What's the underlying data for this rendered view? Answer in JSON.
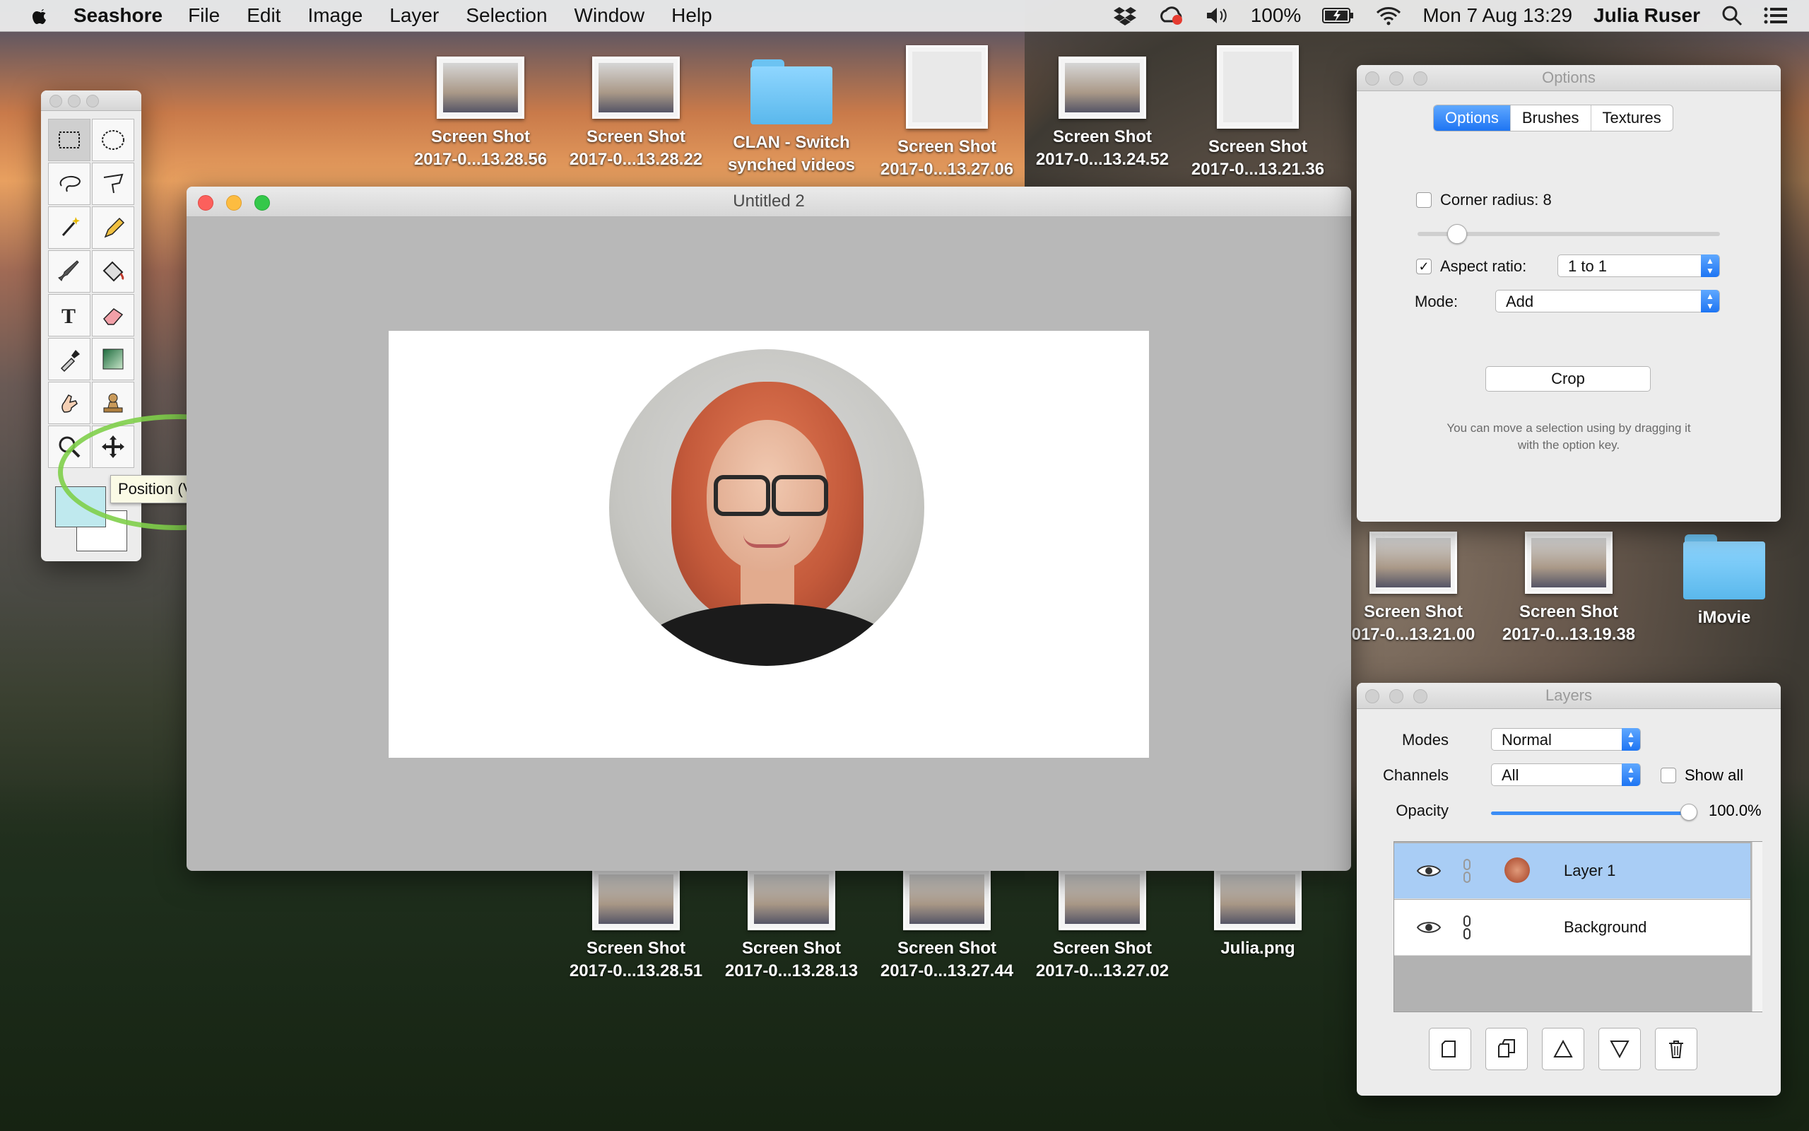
{
  "menubar": {
    "app_name": "Seashore",
    "menus": [
      "File",
      "Edit",
      "Image",
      "Layer",
      "Selection",
      "Window",
      "Help"
    ],
    "battery": "100%",
    "datetime": "Mon 7 Aug  13:29",
    "user": "Julia Ruser",
    "icons": [
      "apple-icon",
      "dropbox-icon",
      "creative-cloud-icon",
      "volume-icon",
      "battery-icon",
      "wifi-icon",
      "spotlight-icon",
      "notification-center-icon"
    ]
  },
  "desktop": {
    "top_icons": [
      {
        "line1": "Screen Shot",
        "line2": "2017-0...13.28.56",
        "kind": "thumb"
      },
      {
        "line1": "Screen Shot",
        "line2": "2017-0...13.28.22",
        "kind": "thumb"
      },
      {
        "line1": "CLAN - Switch",
        "line2": "synched videos",
        "kind": "folder"
      },
      {
        "line1": "Screen Shot",
        "line2": "2017-0...13.27.06",
        "kind": "tall"
      },
      {
        "line1": "Screen Shot",
        "line2": "2017-0...13.24.52",
        "kind": "thumb"
      },
      {
        "line1": "Screen Shot",
        "line2": "2017-0...13.21.36",
        "kind": "tall"
      }
    ],
    "mid_icons": [
      {
        "line1": "Screen Shot",
        "line2": "017-0...13.21.00",
        "kind": "thumb"
      },
      {
        "line1": "Screen Shot",
        "line2": "2017-0...13.19.38",
        "kind": "thumb"
      },
      {
        "line1": "iMovie",
        "line2": "",
        "kind": "folder"
      }
    ],
    "bottom_icons": [
      {
        "line1": "Screen Shot",
        "line2": "2017-0...13.28.51"
      },
      {
        "line1": "Screen Shot",
        "line2": "2017-0...13.28.13"
      },
      {
        "line1": "Screen Shot",
        "line2": "2017-0...13.27.44"
      },
      {
        "line1": "Screen Shot",
        "line2": "2017-0...13.27.02"
      },
      {
        "line1": "Julia.png",
        "line2": ""
      }
    ]
  },
  "tools": {
    "tooltip": "Position (V key)",
    "items": [
      "rect-select",
      "ellipse-select",
      "lasso",
      "polygon-lasso",
      "magic-wand",
      "pencil",
      "brush",
      "bucket",
      "text",
      "eraser",
      "eyedropper",
      "gradient",
      "smudge",
      "clone-stamp",
      "zoom",
      "position"
    ],
    "selected": "rect-select",
    "foreground_color": "#bfe9ee",
    "background_color": "#ffffff"
  },
  "document": {
    "title": "Untitled 2"
  },
  "options_panel": {
    "title": "Options",
    "tabs": [
      "Options",
      "Brushes",
      "Textures"
    ],
    "active_tab": "Options",
    "corner_radius_label": "Corner radius: 8",
    "corner_radius_checked": false,
    "aspect_ratio_label": "Aspect ratio:",
    "aspect_ratio_checked": true,
    "aspect_ratio_value": "1 to 1",
    "mode_label": "Mode:",
    "mode_value": "Add",
    "crop_button": "Crop",
    "hint_line1": "You can move a selection using by dragging it",
    "hint_line2": "with the option key."
  },
  "layers_panel": {
    "title": "Layers",
    "modes_label": "Modes",
    "modes_value": "Normal",
    "channels_label": "Channels",
    "channels_value": "All",
    "show_all_label": "Show all",
    "show_all_checked": false,
    "opacity_label": "Opacity",
    "opacity_value": "100.0%",
    "opacity_fraction": 1.0,
    "layers": [
      {
        "name": "Layer 1",
        "selected": true
      },
      {
        "name": "Background",
        "selected": false
      }
    ],
    "buttons": [
      "new-layer-button",
      "duplicate-layer-button",
      "raise-layer-button",
      "lower-layer-button",
      "delete-layer-button"
    ]
  }
}
